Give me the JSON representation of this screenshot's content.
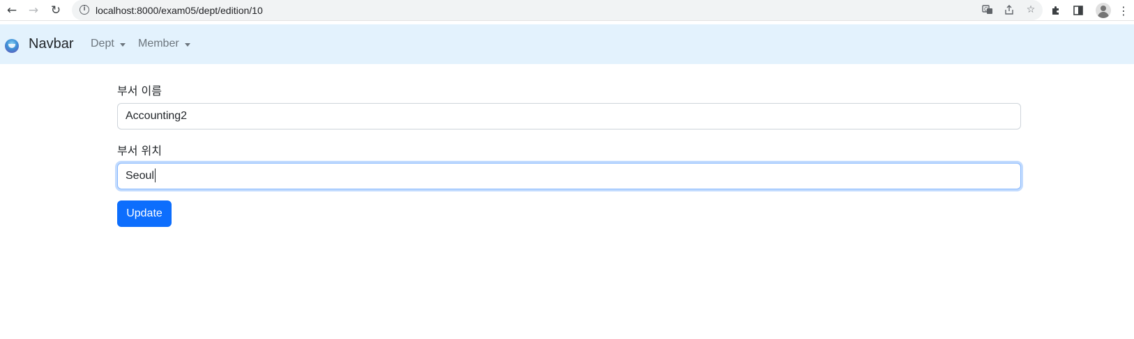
{
  "browser": {
    "url": "localhost:8000/exam05/dept/edition/10",
    "icons": [
      "back-arrow-icon",
      "forward-arrow-icon",
      "reload-icon",
      "info-icon",
      "translate-icon",
      "share-icon",
      "bookmark-star-icon",
      "extensions-puzzle-icon",
      "side-panel-icon",
      "profile-avatar-icon",
      "more-menu-icon"
    ]
  },
  "navbar": {
    "brand": "Navbar",
    "menus": [
      {
        "label": "Dept"
      },
      {
        "label": "Member"
      }
    ],
    "background": "#e3f2fd"
  },
  "form": {
    "fields": [
      {
        "label": "부서 이름",
        "value": "Accounting2",
        "focused": false
      },
      {
        "label": "부서 위치",
        "value": "Seoul",
        "focused": true
      }
    ],
    "submit_label": "Update",
    "accent": "#0d6efd"
  }
}
